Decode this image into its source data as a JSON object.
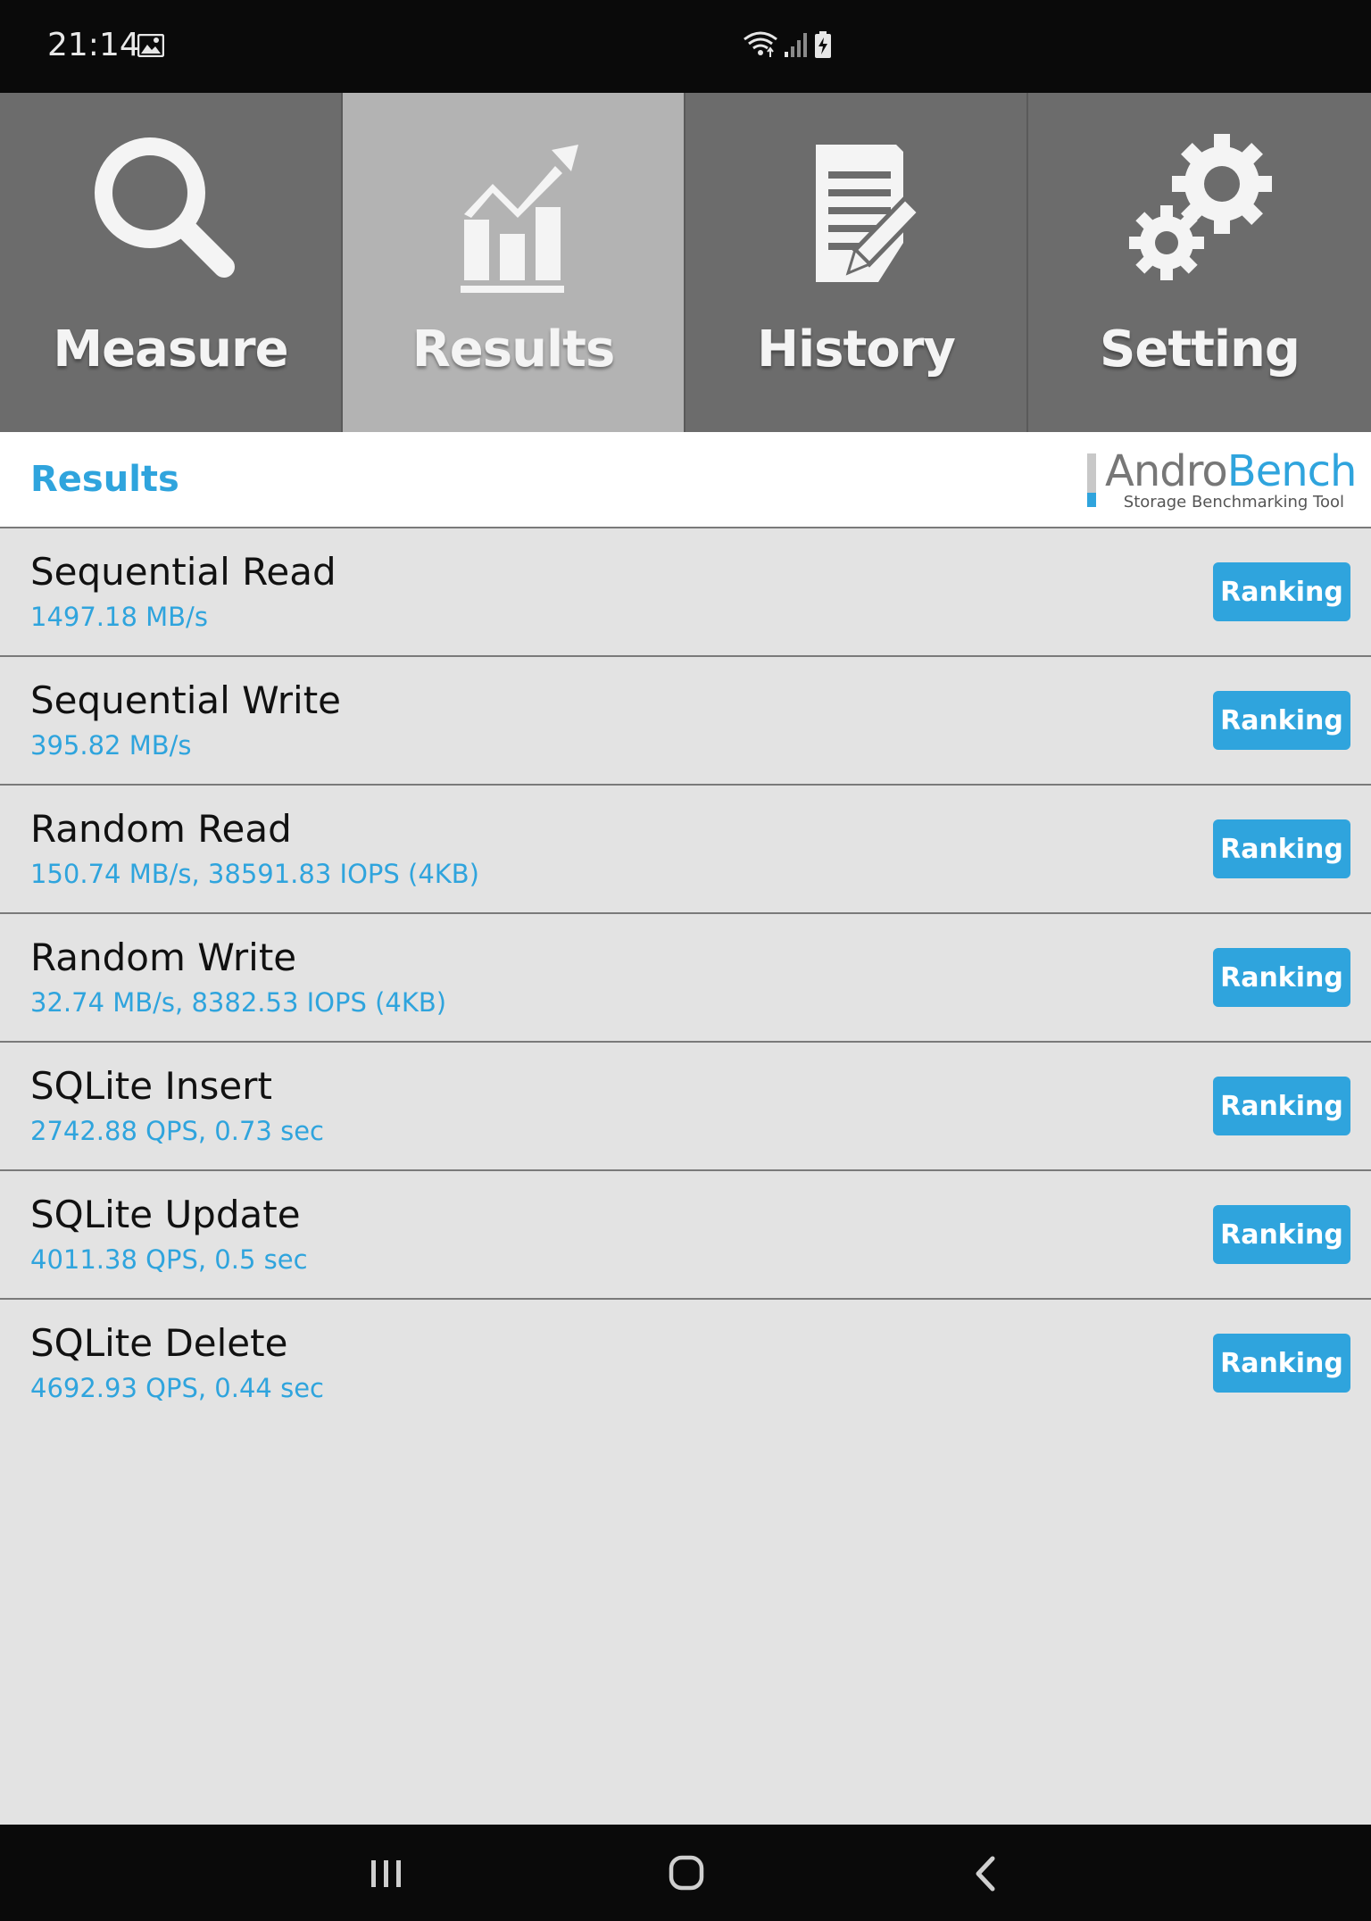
{
  "status_bar": {
    "time": "21:14",
    "left_icons": [
      "image-icon"
    ],
    "right_icons": [
      "wifi-icon",
      "signal-icon",
      "battery-charging-icon"
    ]
  },
  "tabs": [
    {
      "label": "Measure",
      "icon": "magnifier-icon",
      "active": false
    },
    {
      "label": "Results",
      "icon": "bar-chart-trend-icon",
      "active": true
    },
    {
      "label": "History",
      "icon": "document-pen-icon",
      "active": false
    },
    {
      "label": "Setting",
      "icon": "gears-icon",
      "active": false
    }
  ],
  "header": {
    "title": "Results",
    "logo_andro": "Andro",
    "logo_bench": "Bench",
    "logo_tagline": "Storage Benchmarking Tool"
  },
  "results": [
    {
      "name": "Sequential Read",
      "value": "1497.18 MB/s",
      "button": "Ranking"
    },
    {
      "name": "Sequential Write",
      "value": "395.82 MB/s",
      "button": "Ranking"
    },
    {
      "name": "Random Read",
      "value": "150.74 MB/s, 38591.83 IOPS (4KB)",
      "button": "Ranking"
    },
    {
      "name": "Random Write",
      "value": "32.74 MB/s, 8382.53 IOPS (4KB)",
      "button": "Ranking"
    },
    {
      "name": "SQLite Insert",
      "value": "2742.88 QPS, 0.73 sec",
      "button": "Ranking"
    },
    {
      "name": "SQLite Update",
      "value": "4011.38 QPS, 0.5 sec",
      "button": "Ranking"
    },
    {
      "name": "SQLite Delete",
      "value": "4692.93 QPS, 0.44 sec",
      "button": "Ranking"
    }
  ],
  "nav_bar": {
    "buttons": [
      "recent-apps-icon",
      "home-icon",
      "back-icon"
    ]
  },
  "colors": {
    "accent": "#2fa4dd",
    "tab_inactive": "#6c6c6c",
    "tab_active": "#b3b3b3",
    "list_background": "#e3e3e3"
  }
}
